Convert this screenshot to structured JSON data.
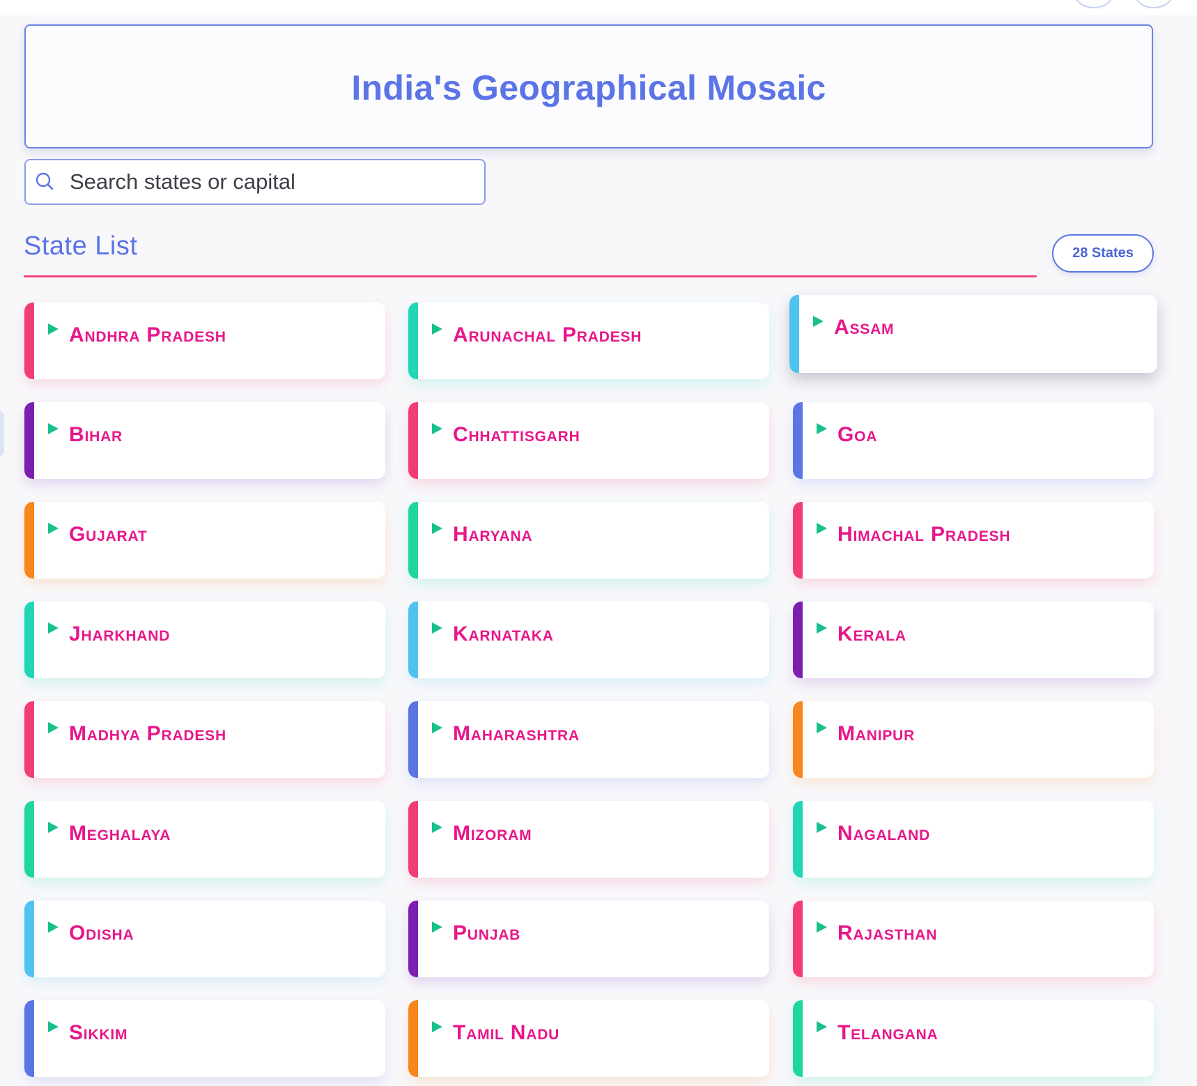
{
  "header": {
    "title": "India's Geographical Mosaic"
  },
  "search": {
    "placeholder": "Search states or capital"
  },
  "list": {
    "title": "State List",
    "count_badge": "28 States"
  },
  "colors": {
    "accent_blue": "#5b74e6",
    "accent_pink": "#e8168a",
    "rule": "#f2447f",
    "arrow": "#18c08e"
  },
  "states": [
    {
      "name": "Andhra Pradesh",
      "accent": "#f23d74",
      "glow": "rgba(242,61,116,0.16)"
    },
    {
      "name": "Arunachal Pradesh",
      "accent": "#20d6b6",
      "glow": "rgba(32,214,182,0.16)"
    },
    {
      "name": "Assam",
      "accent": "#4fc3f0",
      "glow": "rgba(80,80,110,0.30)"
    },
    {
      "name": "Bihar",
      "accent": "#7a1fb0",
      "glow": "rgba(122,31,176,0.16)"
    },
    {
      "name": "Chhattisgarh",
      "accent": "#f23d74",
      "glow": "rgba(242,61,116,0.16)"
    },
    {
      "name": "Goa",
      "accent": "#5b74e6",
      "glow": "rgba(91,116,230,0.16)"
    },
    {
      "name": "Gujarat",
      "accent": "#f7861c",
      "glow": "rgba(247,134,28,0.16)"
    },
    {
      "name": "Haryana",
      "accent": "#1fd6a0",
      "glow": "rgba(31,214,160,0.16)"
    },
    {
      "name": "Himachal Pradesh",
      "accent": "#f23d74",
      "glow": "rgba(242,61,116,0.16)"
    },
    {
      "name": "Jharkhand",
      "accent": "#20d6b6",
      "glow": "rgba(32,214,182,0.16)"
    },
    {
      "name": "Karnataka",
      "accent": "#4fc3f0",
      "glow": "rgba(79,195,240,0.16)"
    },
    {
      "name": "Kerala",
      "accent": "#7a1fb0",
      "glow": "rgba(122,31,176,0.16)"
    },
    {
      "name": "Madhya Pradesh",
      "accent": "#f23d74",
      "glow": "rgba(242,61,116,0.16)"
    },
    {
      "name": "Maharashtra",
      "accent": "#5b74e6",
      "glow": "rgba(91,116,230,0.16)"
    },
    {
      "name": "Manipur",
      "accent": "#f7861c",
      "glow": "rgba(247,134,28,0.16)"
    },
    {
      "name": "Meghalaya",
      "accent": "#1fd6a0",
      "glow": "rgba(31,214,160,0.16)"
    },
    {
      "name": "Mizoram",
      "accent": "#f23d74",
      "glow": "rgba(242,61,116,0.16)"
    },
    {
      "name": "Nagaland",
      "accent": "#20d6b6",
      "glow": "rgba(32,214,182,0.16)"
    },
    {
      "name": "Odisha",
      "accent": "#4fc3f0",
      "glow": "rgba(79,195,240,0.16)"
    },
    {
      "name": "Punjab",
      "accent": "#7a1fb0",
      "glow": "rgba(122,31,176,0.16)"
    },
    {
      "name": "Rajasthan",
      "accent": "#f23d74",
      "glow": "rgba(242,61,116,0.16)"
    },
    {
      "name": "Sikkim",
      "accent": "#5b74e6",
      "glow": "rgba(91,116,230,0.16)"
    },
    {
      "name": "Tamil Nadu",
      "accent": "#f7861c",
      "glow": "rgba(247,134,28,0.16)"
    },
    {
      "name": "Telangana",
      "accent": "#1fd6a0",
      "glow": "rgba(31,214,160,0.16)"
    }
  ]
}
